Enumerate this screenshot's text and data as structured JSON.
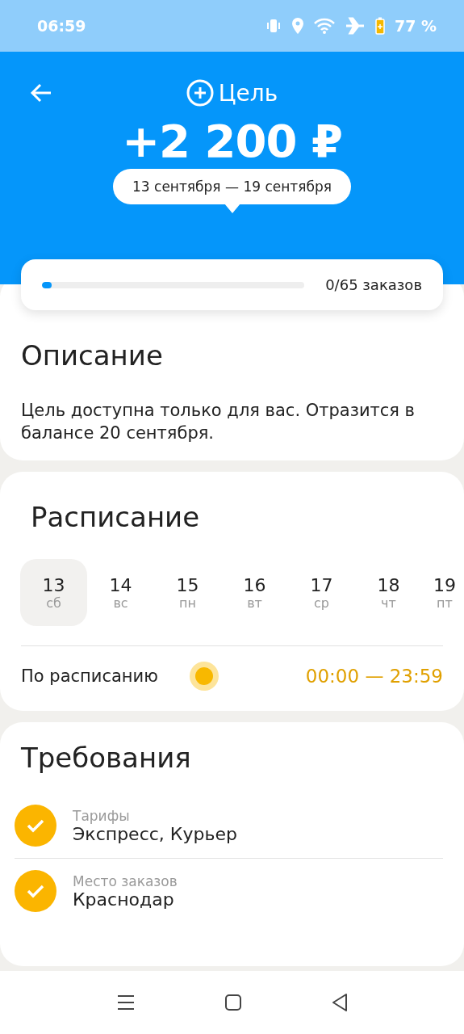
{
  "status_bar": {
    "time": "06:59",
    "battery": "77 %"
  },
  "header": {
    "title": "Цель",
    "amount": "+2 200 ₽",
    "period": "13 сентября — 19 сентября"
  },
  "progress": {
    "level": 0.02,
    "reading": "0/65 заказов"
  },
  "description": {
    "title": "Описание",
    "text": "Цель доступна только для вас. Отразится в балансе 20 сентября."
  },
  "schedule": {
    "title": "Расписание",
    "days": [
      {
        "date": "13",
        "weekday": "сб",
        "selected": true
      },
      {
        "date": "14",
        "weekday": "вс",
        "selected": false
      },
      {
        "date": "15",
        "weekday": "пн",
        "selected": false
      },
      {
        "date": "16",
        "weekday": "вт",
        "selected": false
      },
      {
        "date": "17",
        "weekday": "ср",
        "selected": false
      },
      {
        "date": "18",
        "weekday": "чт",
        "selected": false
      },
      {
        "date": "19",
        "weekday": "пт",
        "selected": false
      }
    ],
    "label": "По расписанию",
    "hours": "00:00 — 23:59"
  },
  "requirements": {
    "title": "Требования",
    "items": [
      {
        "label": "Тарифы",
        "value": "Экспресс, Курьер",
        "checked": true
      },
      {
        "label": "Место заказов",
        "value": "Краснодар",
        "checked": true
      }
    ]
  }
}
